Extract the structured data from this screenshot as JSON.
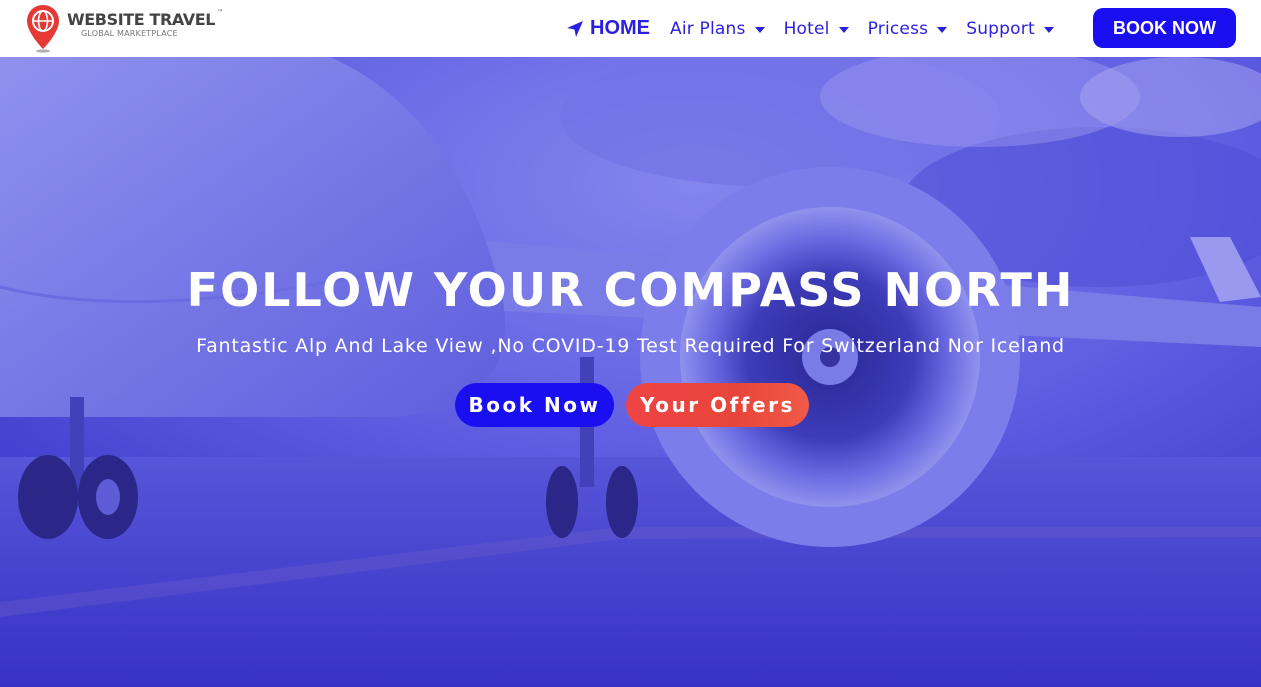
{
  "brand": {
    "name": "WEBSITE TRAVEL",
    "trademark": "™",
    "tagline": "GLOBAL MARKETPLACE",
    "colors": {
      "pin": "#e53935",
      "text": "#444444"
    }
  },
  "nav": {
    "home": {
      "label": "HOME",
      "icon": "location-arrow-icon"
    },
    "items": [
      {
        "label": "Air Plans",
        "icon": "caret-down-icon"
      },
      {
        "label": "Hotel",
        "icon": "caret-down-icon"
      },
      {
        "label": "Pricess",
        "icon": "caret-down-icon"
      },
      {
        "label": "Support",
        "icon": "caret-down-icon"
      }
    ],
    "cta": "BOOK NOW"
  },
  "hero": {
    "title": "FOLLOW YOUR COMPASS NORTH",
    "subtitle": "Fantastic Alp And Lake View ,No COVID-19 Test Required For Switzerland Nor Iceland",
    "primary_button": "Book Now",
    "secondary_button": "Your Offers"
  },
  "colors": {
    "accent": "#1a0ff0",
    "nav_text": "#2a1fe0",
    "offers_button": "#ef4444",
    "hero_tint": "#5656df"
  }
}
